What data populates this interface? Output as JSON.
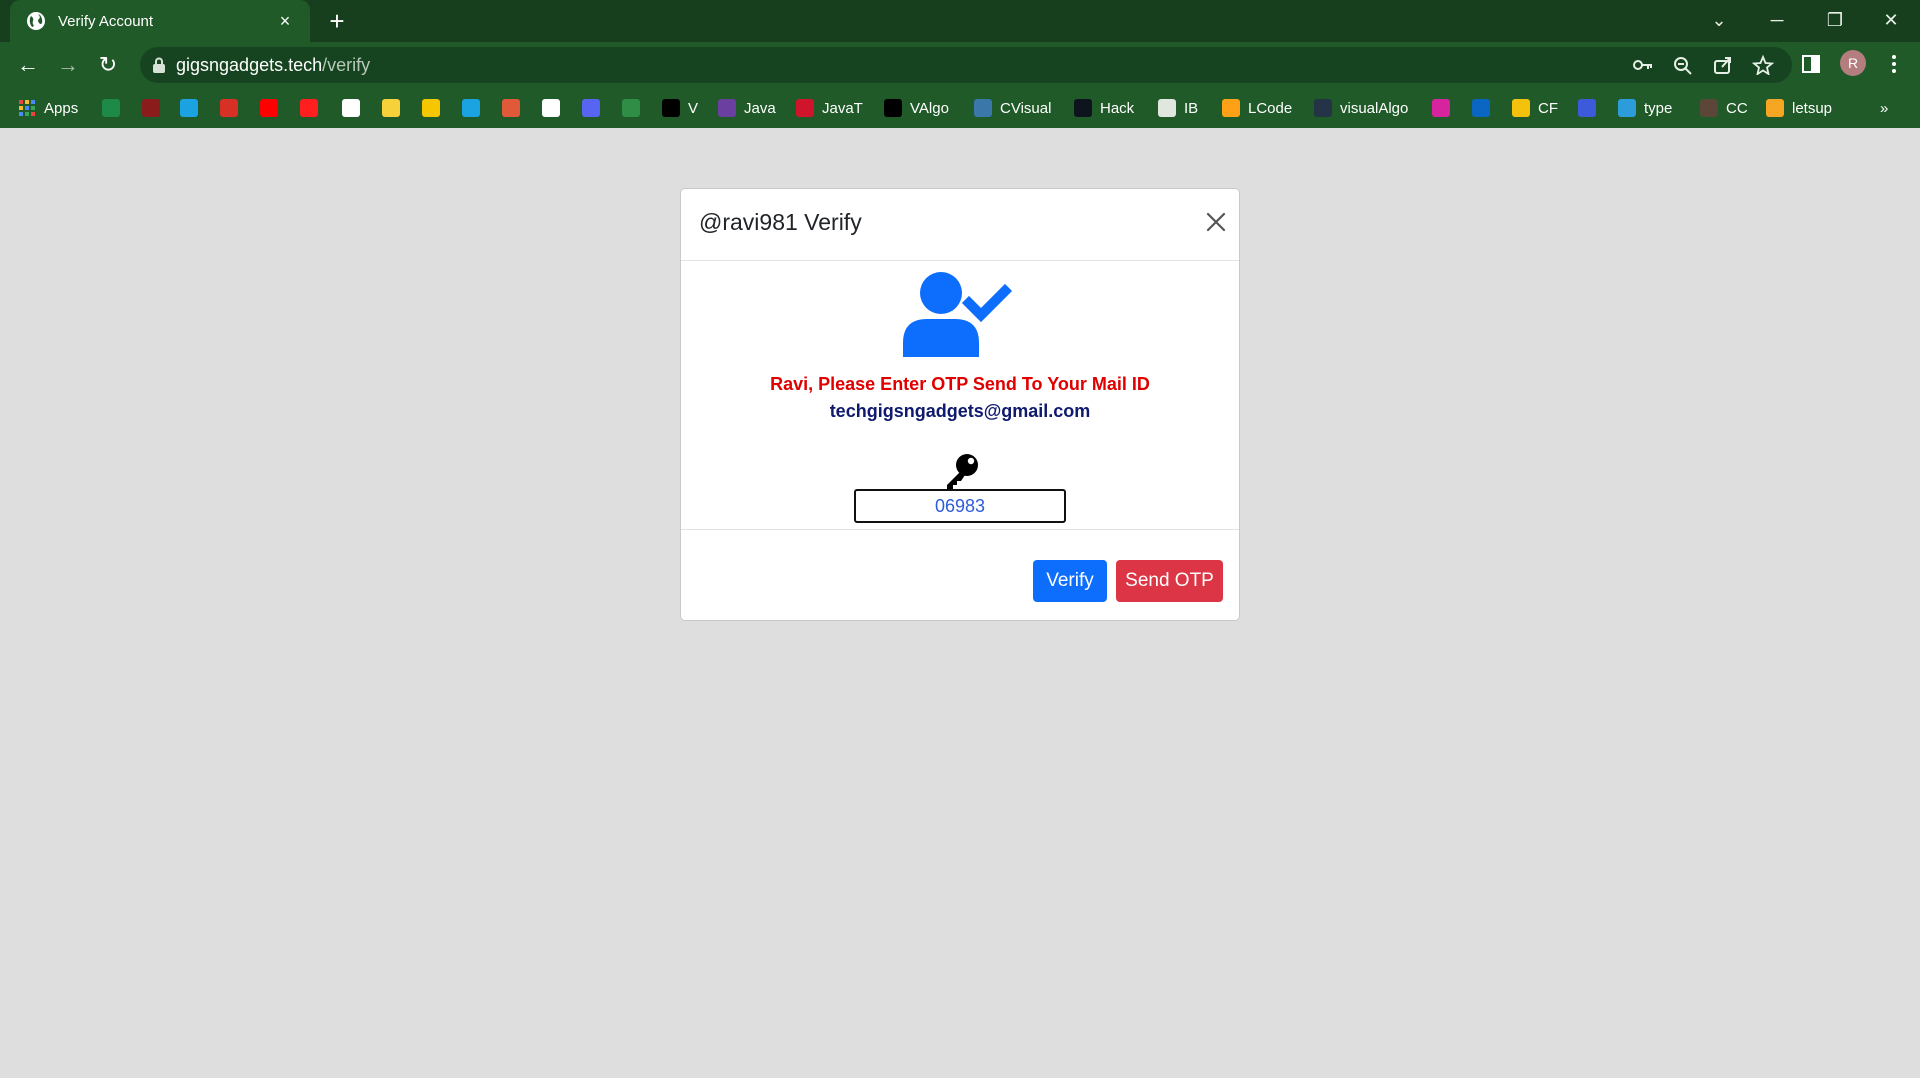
{
  "browser": {
    "tab_title": "Verify Account",
    "tab_close": "×",
    "new_tab": "+",
    "url_host": "gigsngadgets.tech",
    "url_path": "/verify",
    "window_controls": {
      "minimize": "─",
      "restore": "❐",
      "close": "✕",
      "tab_search": "⌄"
    },
    "nav": {
      "back": "←",
      "forward": "→",
      "reload": "↻"
    },
    "omnibox_icons": [
      "key-icon",
      "zoom-icon",
      "share-icon",
      "star-icon"
    ],
    "profile_initial": "R",
    "accent": "#1f5a28"
  },
  "bookmarks": [
    {
      "label": "Apps",
      "icon": "apps-grid-icon",
      "color": "#e8453c"
    },
    {
      "label": "",
      "icon": "excel-icon",
      "color": "#1d8a4a"
    },
    {
      "label": "",
      "icon": "arch-icon",
      "color": "#8a1c1c"
    },
    {
      "label": "",
      "icon": "p-icon",
      "color": "#1aa3e0"
    },
    {
      "label": "",
      "icon": "gmail-icon",
      "color": "#d93025"
    },
    {
      "label": "",
      "icon": "youtube-icon",
      "color": "#ff0000"
    },
    {
      "label": "",
      "icon": "youtube-music-icon",
      "color": "#ff1f1f"
    },
    {
      "label": "",
      "icon": "amazon-icon",
      "color": "#ffffff"
    },
    {
      "label": "",
      "icon": "flipkart-icon",
      "color": "#f7d13a"
    },
    {
      "label": "",
      "icon": "paytm-p-icon",
      "color": "#f6c700"
    },
    {
      "label": "",
      "icon": "arrow-dev-icon",
      "color": "#1aa3e0"
    },
    {
      "label": "",
      "icon": "code-icon",
      "color": "#e05a3a"
    },
    {
      "label": "",
      "icon": "github-icon",
      "color": "#ffffff"
    },
    {
      "label": "",
      "icon": "discord-icon",
      "color": "#5865f2"
    },
    {
      "label": "",
      "icon": "gfg-icon",
      "color": "#2f8d46"
    },
    {
      "label": "V",
      "icon": "triangle-icon",
      "color": "#000000"
    },
    {
      "label": "Java",
      "icon": "bolt-icon",
      "color": "#6b3fa0"
    },
    {
      "label": "JavaT",
      "icon": "javat-icon",
      "color": "#d0142c"
    },
    {
      "label": "VAlgo",
      "icon": "valgo-icon",
      "color": "#000000"
    },
    {
      "label": "CVisual",
      "icon": "python-icon",
      "color": "#3b77a8"
    },
    {
      "label": "Hack",
      "icon": "hackerrank-icon",
      "color": "#0e141e"
    },
    {
      "label": "IB",
      "icon": "mountain-icon",
      "color": "#dfe7df"
    },
    {
      "label": "LCode",
      "icon": "leetcode-icon",
      "color": "#ffa116"
    },
    {
      "label": "visualAlgo",
      "icon": "visualalgo-icon",
      "color": "#253347"
    },
    {
      "label": "",
      "icon": "instagram-icon",
      "color": "#d6249f"
    },
    {
      "label": "",
      "icon": "linkedin-icon",
      "color": "#0a66c2"
    },
    {
      "label": "CF",
      "icon": "codeforces-icon",
      "color": "#f4c20d"
    },
    {
      "label": "",
      "icon": "link-icon",
      "color": "#3b5bdb"
    },
    {
      "label": "type",
      "icon": "typeracer-icon",
      "color": "#2d9cdb"
    },
    {
      "label": "CC",
      "icon": "codechef-icon",
      "color": "#5b4638"
    },
    {
      "label": "letsup",
      "icon": "letsupgrade-icon",
      "color": "#f5a623"
    },
    {
      "label": "»",
      "icon": "overflow-chevron-icon",
      "color": "#ffffff"
    }
  ],
  "modal": {
    "title": "@ravi981 Verify",
    "message": "Ravi, Please Enter OTP Send To Your Mail ID",
    "email": "techgigsngadgets@gmail.com",
    "otp_value": "06983",
    "verify_label": "Verify",
    "send_otp_label": "Send OTP",
    "colors": {
      "primary": "#0d6efd",
      "danger": "#dc3545",
      "message": "#e00000",
      "email": "#0f1a6e"
    }
  }
}
